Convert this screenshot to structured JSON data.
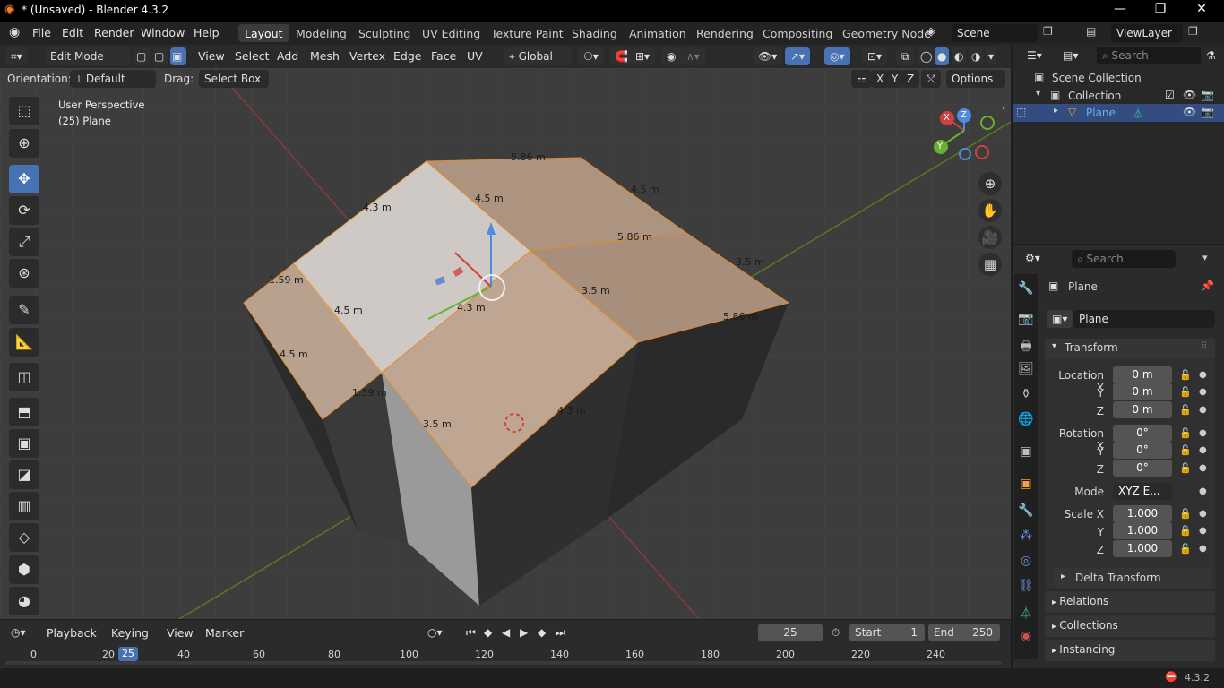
{
  "window": {
    "title": "* (Unsaved) - Blender 4.3.2",
    "min": "—",
    "max": "❐",
    "close": "✕"
  },
  "menu": [
    "File",
    "Edit",
    "Render",
    "Window",
    "Help"
  ],
  "workspaces": [
    "Layout",
    "Modeling",
    "Sculpting",
    "UV Editing",
    "Texture Paint",
    "Shading",
    "Animation",
    "Rendering",
    "Compositing",
    "Geometry Node"
  ],
  "scene": {
    "name": "Scene",
    "viewlayer": "ViewLayer"
  },
  "header": {
    "mode": "Edit Mode",
    "menus": [
      "View",
      "Select",
      "Add",
      "Mesh",
      "Vertex",
      "Edge",
      "Face",
      "UV"
    ],
    "transform": "Global"
  },
  "subheader": {
    "orientation_label": "Orientation:",
    "orientation": "Default",
    "drag_label": "Drag:",
    "drag": "Select Box",
    "axes": [
      "X",
      "Y",
      "Z"
    ],
    "options": "Options"
  },
  "viewport": {
    "perspective": "User Perspective",
    "object": "(25) Plane",
    "measurements": [
      "5.86 m",
      "4.5 m",
      "4.3 m",
      "4.5 m",
      "5.86 m",
      "3.5 m",
      "1.59 m",
      "4.5 m",
      "4.3 m",
      "3.5 m",
      "5.86 m",
      "4.5 m",
      "1.59 m",
      "3.5 m",
      "4.3 m"
    ],
    "gizmo": {
      "x": "X",
      "y": "Y",
      "z": "Z"
    }
  },
  "timeline": {
    "menus": [
      "Playback",
      "Keying",
      "View",
      "Marker"
    ],
    "current": "25",
    "start_label": "Start",
    "start": "1",
    "end_label": "End",
    "end": "250",
    "ticks": [
      "0",
      "20",
      "40",
      "60",
      "80",
      "100",
      "120",
      "140",
      "160",
      "180",
      "200",
      "220",
      "240"
    ],
    "playhead": "25"
  },
  "outliner": {
    "search": "Search",
    "root": "Scene Collection",
    "collection": "Collection",
    "object": "Plane"
  },
  "properties": {
    "search": "Search",
    "object": "Plane",
    "data_name": "Plane",
    "transform_title": "Transform",
    "location": {
      "label": "Location X",
      "x": "0 m",
      "y": "0 m",
      "z": "0 m"
    },
    "rotation": {
      "label": "Rotation X",
      "x": "0°",
      "y": "0°",
      "z": "0°"
    },
    "mode_label": "Mode",
    "mode": "XYZ E...",
    "scale": {
      "label": "Scale X",
      "x": "1.000",
      "y": "1.000",
      "z": "1.000"
    },
    "axis_y": "Y",
    "axis_z": "Z",
    "panels": [
      "Delta Transform",
      "Relations",
      "Collections",
      "Instancing"
    ]
  },
  "status": {
    "version": "4.3.2"
  }
}
